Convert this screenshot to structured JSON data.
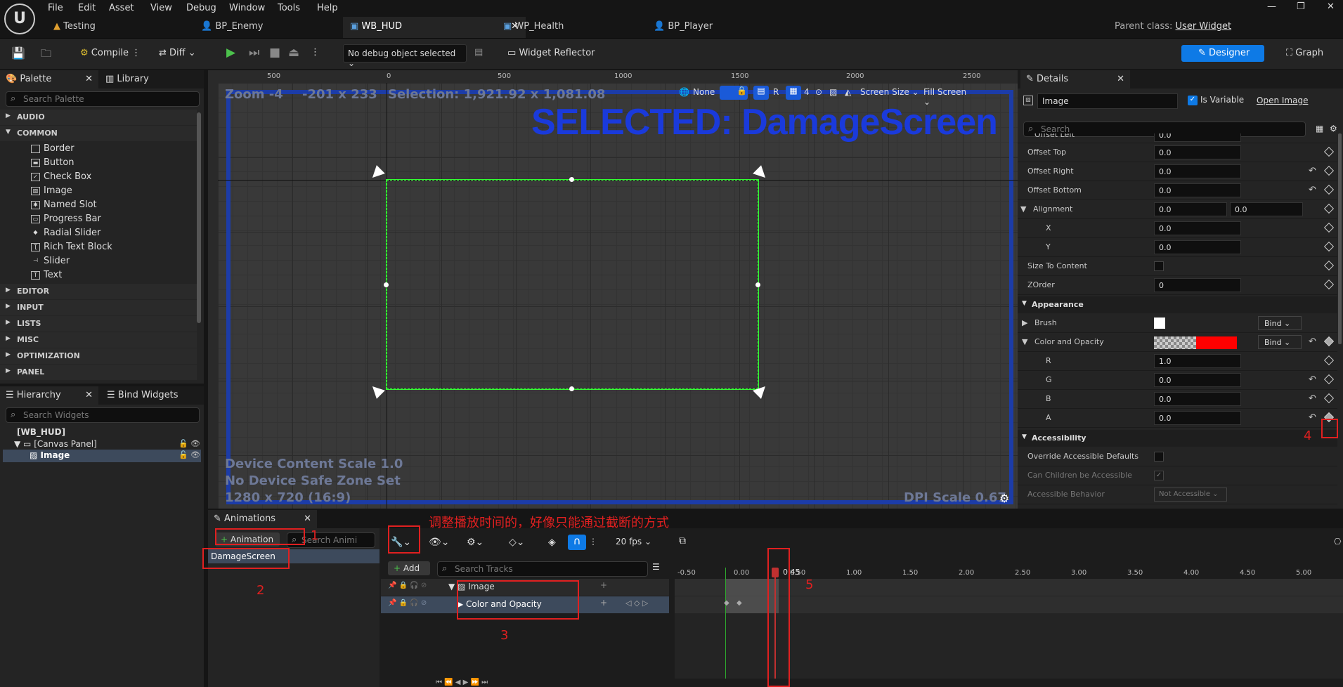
{
  "menu": [
    "File",
    "Edit",
    "Asset",
    "View",
    "Debug",
    "Window",
    "Tools",
    "Help"
  ],
  "logo": "U",
  "tabs": [
    {
      "label": "Testing"
    },
    {
      "label": "BP_Enemy"
    },
    {
      "label": "WB_HUD",
      "close": "✕"
    },
    {
      "label": "WP_Health"
    },
    {
      "label": "BP_Player"
    }
  ],
  "parent_class": {
    "label": "Parent class:",
    "value": "User Widget"
  },
  "toolbar": {
    "compile": "Compile",
    "diff": "Diff",
    "debug_select": "No debug object selected",
    "widget_reflector": "Widget Reflector",
    "designer": "Designer",
    "graph": "Graph"
  },
  "palette": {
    "tab": "Palette",
    "library": "Library",
    "search": "Search Palette",
    "cats_top": [
      "AUDIO",
      "COMMON"
    ],
    "items": [
      "Border",
      "Button",
      "Check Box",
      "Image",
      "Named Slot",
      "Progress Bar",
      "Radial Slider",
      "Rich Text Block",
      "Slider",
      "Text"
    ],
    "cats_bottom": [
      "EDITOR",
      "INPUT",
      "LISTS",
      "MISC",
      "OPTIMIZATION",
      "PANEL"
    ]
  },
  "hierarchy": {
    "tab": "Hierarchy",
    "bind": "Bind Widgets",
    "search": "Search Widgets",
    "root": "[WB_HUD]",
    "canvas": "[Canvas Panel]",
    "image": "Image"
  },
  "viewport": {
    "zoom": "Zoom -4",
    "coords": "-201 x 233",
    "selection": "Selection: 1,921.92 x 1,081.08",
    "none": "None",
    "r": "R",
    "grid": "4",
    "screen_size": "Screen Size",
    "fill_screen": "Fill Screen",
    "selected": "SELECTED: DamageScreen",
    "device_scale": "Device Content Scale 1.0",
    "safe_zone": "No Device Safe Zone Set",
    "resolution": "1280 x 720 (16:9)",
    "dpi": "DPI Scale 0.67",
    "ruler": [
      "500",
      "0",
      "500",
      "1000",
      "1500",
      "2000",
      "2500"
    ]
  },
  "details": {
    "tab": "Details",
    "name": "Image",
    "is_variable": "Is Variable",
    "open_image": "Open Image",
    "search": "Search",
    "rows": [
      {
        "label": "Offset Left",
        "value": "0.0"
      },
      {
        "label": "Offset Top",
        "value": "0.0"
      },
      {
        "label": "Offset Right",
        "value": "0.0"
      },
      {
        "label": "Offset Bottom",
        "value": "0.0"
      },
      {
        "label": "Alignment",
        "value": "0.0",
        "value2": "0.0"
      },
      {
        "label": "X",
        "value": "0.0"
      },
      {
        "label": "Y",
        "value": "0.0"
      },
      {
        "label": "Size To Content",
        "value": ""
      },
      {
        "label": "ZOrder",
        "value": "0"
      }
    ],
    "appearance": "Appearance",
    "brush": "Brush",
    "color_opacity": "Color and Opacity",
    "bind": "Bind",
    "rgba": [
      {
        "label": "R",
        "value": "1.0"
      },
      {
        "label": "G",
        "value": "0.0"
      },
      {
        "label": "B",
        "value": "0.0"
      },
      {
        "label": "A",
        "value": "0.0"
      }
    ],
    "accessibility": "Accessibility",
    "override": "Override Accessible Defaults",
    "children": "Can Children be Accessible",
    "behavior": "Accessible Behavior",
    "not_accessible": "Not Accessible"
  },
  "animations": {
    "tab": "Animations",
    "add": "Animation",
    "search": "Search Animi",
    "item": "DamageScreen",
    "fps": "20 fps",
    "add_track": "Add",
    "search_tracks": "Search Tracks",
    "track_image": "Image",
    "track_color": "Color and Opacity",
    "time": "0.45",
    "ruler": [
      "-0.50",
      "0.00",
      "0.50",
      "1.00",
      "1.50",
      "2.00",
      "2.50",
      "3.00",
      "3.50",
      "4.00",
      "4.50",
      "5.00"
    ]
  },
  "annotations": {
    "note": "调整播放时间的，好像只能通过截断的方式",
    "n1": "1",
    "n2": "2",
    "n3": "3",
    "n4": "4",
    "n5": "5"
  },
  "colors": {
    "accent": "#0e7ae6",
    "selected_text": "#1a3adb",
    "annotation": "#e02020",
    "selection_outline": "#33ff33"
  }
}
